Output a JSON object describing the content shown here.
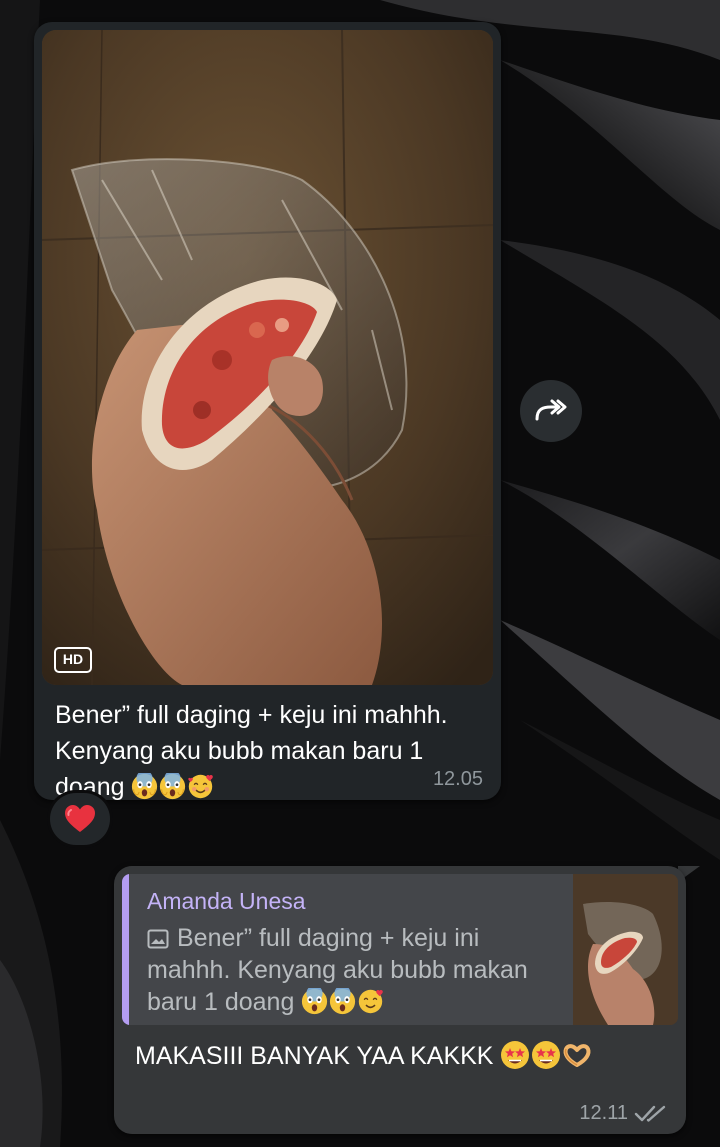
{
  "incoming_message": {
    "caption": "Bener” full daging + keju ini mahhh. Kenyang aku bubb makan baru 1 doang",
    "caption_emojis": [
      "face-screaming-in-fear",
      "face-screaming-in-fear",
      "smiling-face-with-hearts"
    ],
    "time": "12.05",
    "photo_badge": "HD",
    "photo_description_icon": "food-photo",
    "reaction": "heart"
  },
  "outgoing_message": {
    "reply": {
      "author": "Amanda Unesa",
      "text": "Bener” full daging + keju ini mahhh. Kenyang aku bubb makan baru 1 doang",
      "text_emojis": [
        "face-screaming-in-fear",
        "face-screaming-in-fear",
        "smiling-face-with-hearts"
      ],
      "icon": "image-icon"
    },
    "text": "MAKASIII BANYAK YAA KAKKK",
    "text_emojis": [
      "star-struck",
      "star-struck",
      "heart-hands"
    ],
    "time": "12.11",
    "status": "read"
  },
  "colors": {
    "background": "#0b0b0c",
    "bubble_in": "#212528",
    "bubble_out": "#353739",
    "reply_accent": "#b49df2",
    "timestamp": "#8f979c"
  }
}
